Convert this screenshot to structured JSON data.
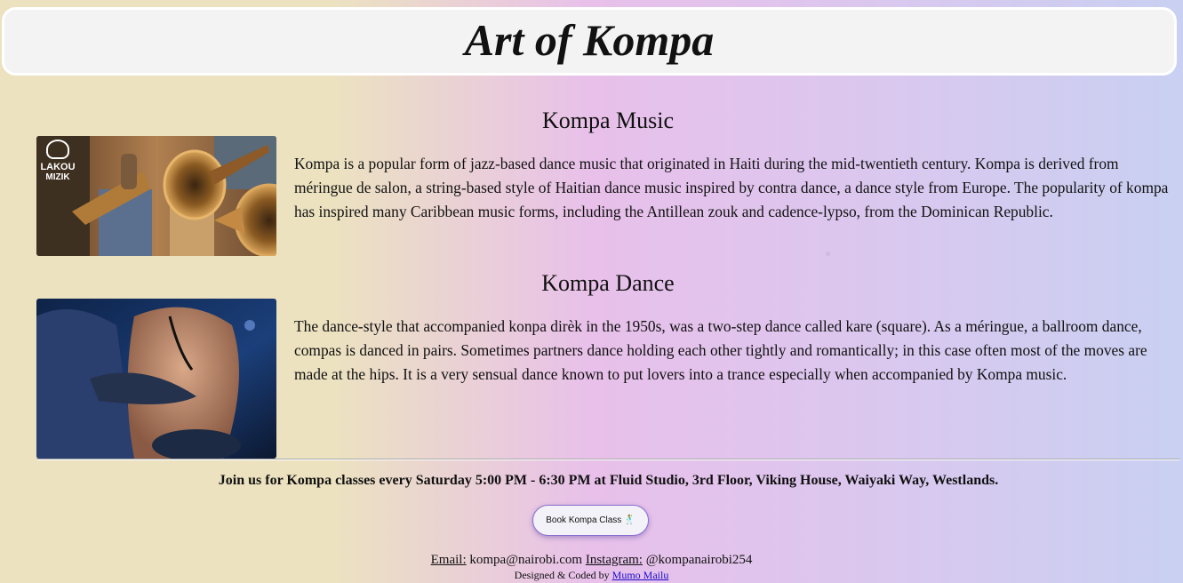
{
  "header": {
    "title": "Art of Kompa"
  },
  "music": {
    "title": "Kompa Music",
    "logo_top": "LAKOU",
    "logo_bottom": "MIZIK",
    "text": "Kompa is a popular form of jazz-based dance music that originated in Haiti during the mid-twentieth century. Kompa is derived from méringue de salon, a string-based style of Haitian dance music inspired by contra dance, a dance style from Europe. The popularity of kompa has inspired many Caribbean music forms, including the Antillean zouk and cadence-lypso, from the Dominican Republic."
  },
  "dance": {
    "title": "Kompa Dance",
    "text": "The dance-style that accompanied konpa dirèk in the 1950s, was a two-step dance called kare (square). As a méringue, a ballroom dance, compas is danced in pairs. Sometimes partners dance holding each other tightly and romantically; in this case often most of the moves are made at the hips. It is a very sensual dance known to put lovers into a trance especially when accompanied by Kompa music."
  },
  "classes": {
    "info": "Join us for Kompa classes every Saturday 5:00 PM - 6:30 PM at Fluid Studio, 3rd Floor, Viking House, Waiyaki Way, Westlands.",
    "button_label": "Book Kompa Class",
    "button_icon": "🕺"
  },
  "contact": {
    "email_label": "Email:",
    "email": "kompa@nairobi.com",
    "instagram_label": "Instagram:",
    "instagram": "@kompanairobi254"
  },
  "footer": {
    "credit_prefix": "Designed & Coded by",
    "author": "Mumo Mailu"
  },
  "colors": {
    "bg_left": "#ece2c0",
    "bg_middle": "#e8c0ea",
    "bg_right": "#c9d0f2",
    "header_bg": "#f3f3f3",
    "link": "#1a0dcc",
    "button_border": "#8a6fd0"
  }
}
